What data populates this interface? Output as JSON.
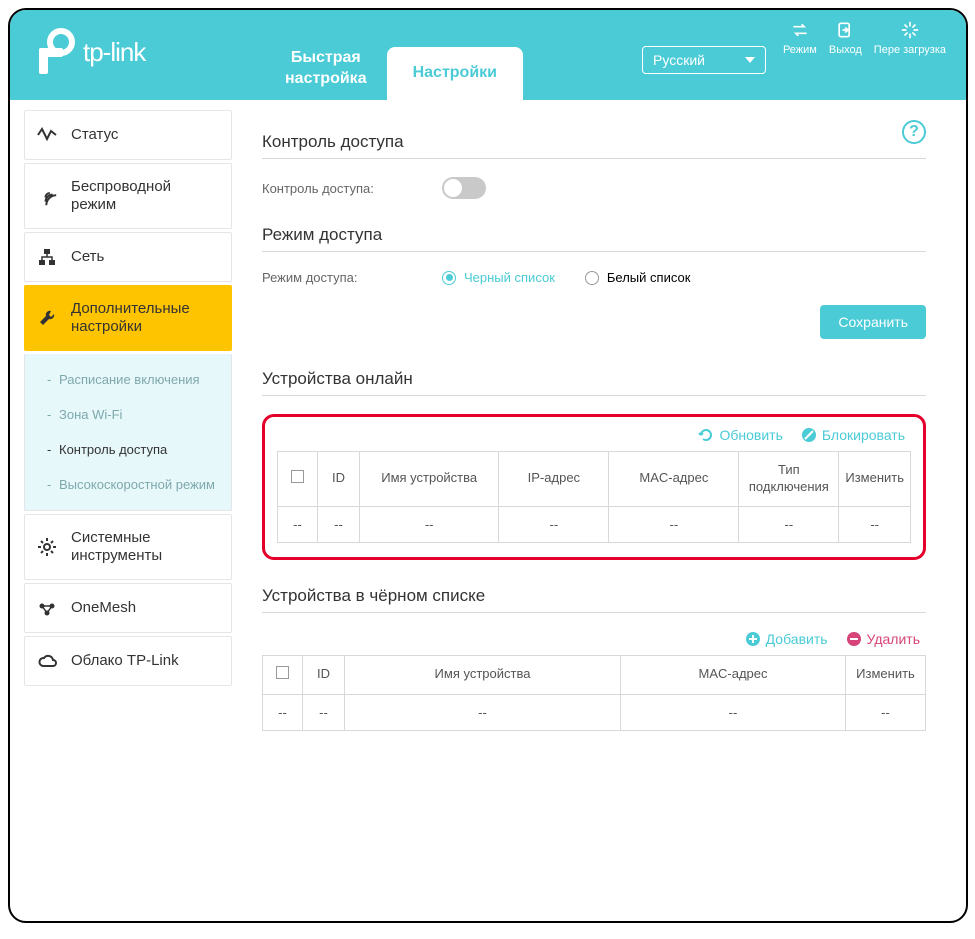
{
  "brand": "tp-link",
  "topTabs": {
    "quick": "Быстрая\nнастройка",
    "settings": "Настройки"
  },
  "lang": "Русский",
  "topButtons": {
    "mode": "Режим",
    "logout": "Выход",
    "reboot": "Пере загрузка"
  },
  "menu": {
    "status": "Статус",
    "wireless": "Беспроводной режим",
    "network": "Сеть",
    "advanced": "Дополнительные настройки",
    "tools": "Системные инструменты",
    "onemesh": "OneMesh",
    "cloud": "Облако TP-Link"
  },
  "submenu": {
    "schedule": "Расписание включения",
    "wifizone": "Зона Wi-Fi",
    "access": "Контроль доступа",
    "highspeed": "Высокоскоростной режим"
  },
  "sections": {
    "accessControl": {
      "title": "Контроль доступа",
      "label": "Контроль доступа:"
    },
    "accessMode": {
      "title": "Режим доступа",
      "label": "Режим доступа:",
      "black": "Черный список",
      "white": "Белый список"
    },
    "save": "Сохранить",
    "onlineDevices": {
      "title": "Устройства онлайн",
      "refresh": "Обновить",
      "block": "Блокировать",
      "cols": {
        "id": "ID",
        "name": "Имя устройства",
        "ip": "IP-адрес",
        "mac": "MAC-адрес",
        "conn": "Тип подключения",
        "mod": "Изменить"
      },
      "empty": "--"
    },
    "blacklist": {
      "title": "Устройства в чёрном списке",
      "add": "Добавить",
      "del": "Удалить",
      "cols": {
        "id": "ID",
        "name": "Имя устройства",
        "mac": "MAC-адрес",
        "mod": "Изменить"
      },
      "empty": "--"
    }
  }
}
